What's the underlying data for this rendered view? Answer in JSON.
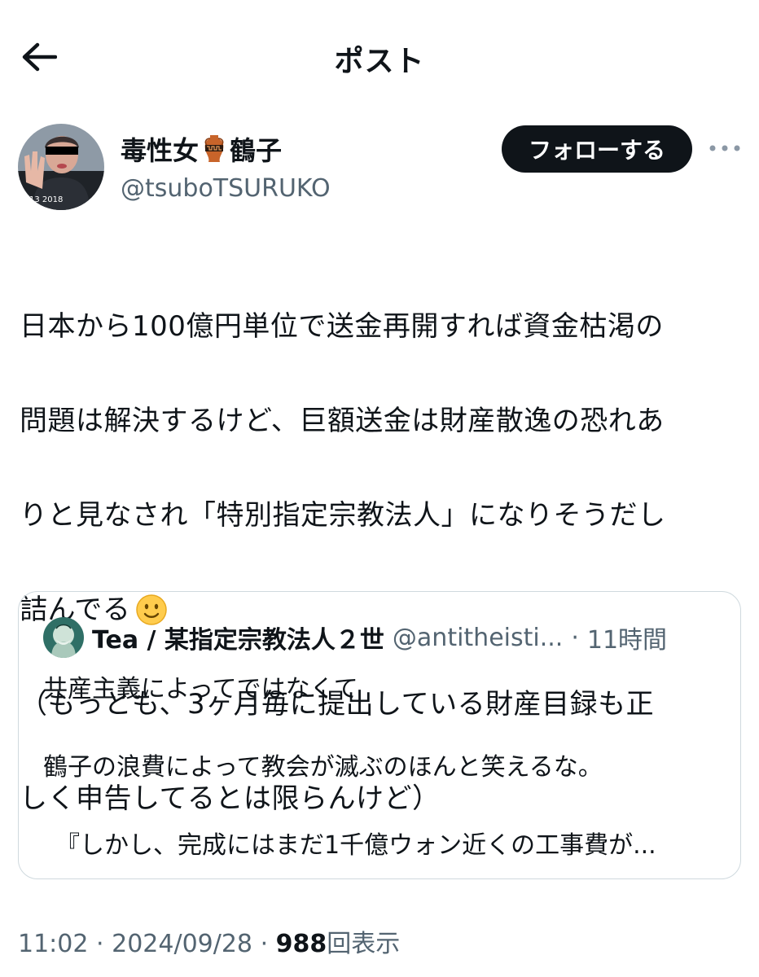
{
  "header": {
    "title": "ポスト",
    "back_icon": "arrow-left-icon"
  },
  "author": {
    "display_name": "毒性女",
    "name_emoji": "amphora-emoji",
    "display_name_suffix": "鶴子",
    "handle": "@tsuboTSURUKO",
    "avatar_caption": "13 2018",
    "follow_label": "フォローする",
    "more_icon": "more-horizontal-icon"
  },
  "post": {
    "lines": [
      "日本から100億円単位で送金再開すれば資金枯渇の",
      "問題は解決するけど、巨額送金は財産散逸の恐れあ",
      "りと見なされ「特別指定宗教法人」になりそうだし",
      "詰んでる",
      "（もっとも、3ヶ月毎に提出している財産目録も正",
      "しく申告してるとは限らんけど）"
    ],
    "emoji": "slightly-smiling-face-emoji"
  },
  "quote": {
    "name": "Tea / 某指定宗教法人２世",
    "handle": "@antitheisti...",
    "separator": "·",
    "time": "11時間",
    "line1": "共産主義によってではなくて",
    "line2": "鶴子の浪費によって教会が滅ぶのほんと笑えるな。",
    "line3": "　『しかし、完成にはまだ1千億ウォン近くの工事費が..."
  },
  "meta": {
    "time": "11:02",
    "sep1": "·",
    "date": "2024/09/28",
    "sep2": "·",
    "views": "988",
    "views_label": "回表示"
  },
  "colors": {
    "text": "#0f1419",
    "secondary": "#536471",
    "border": "#cfd9de",
    "button": "#0f1419"
  }
}
